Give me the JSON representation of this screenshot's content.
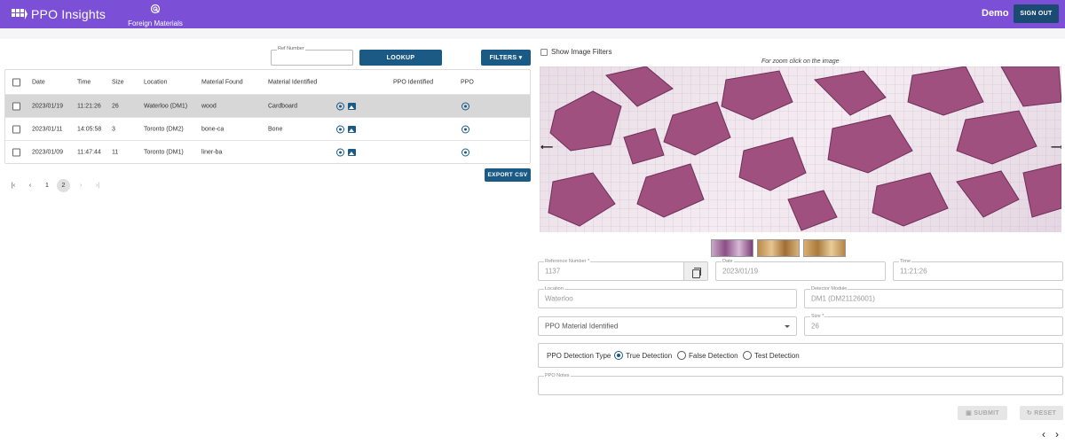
{
  "header": {
    "app_title": "PPO Insights",
    "nav_item": "Foreign Materials",
    "user": "Demo",
    "sign_out": "SIGN OUT"
  },
  "controls": {
    "ref_label": "Ref Number",
    "ref_value": "",
    "lookup": "LOOKUP",
    "filters": "FILTERS ▾",
    "show_filters": "Show Image Filters",
    "zoom_hint": "For zoom click on the image",
    "export": "EXPORT CSV"
  },
  "table": {
    "columns": [
      "Date",
      "Time",
      "Size",
      "Location",
      "Material Found",
      "Material Identified",
      "PPO Identified",
      "PPO"
    ],
    "rows": [
      {
        "date": "2023/01/19",
        "time": "11:21:26",
        "size": "26",
        "location": "Waterloo (DM1)",
        "material_found": "wood",
        "material_identified": "Cardboard",
        "selected": true
      },
      {
        "date": "2023/01/11",
        "time": "14:05:58",
        "size": "3",
        "location": "Toronto (DM2)",
        "material_found": "bone-ca",
        "material_identified": "Bone",
        "selected": false
      },
      {
        "date": "2023/01/09",
        "time": "11:47:44",
        "size": "11",
        "location": "Toronto (DM1)",
        "material_found": "liner-ba",
        "material_identified": "",
        "selected": false
      }
    ]
  },
  "pagination": {
    "first": "|‹",
    "prev": "‹",
    "pages": [
      "1",
      "2"
    ],
    "current": "2",
    "next": "›",
    "last": "›|"
  },
  "form": {
    "reference_label": "Reference Number *",
    "reference_value": "1137",
    "date_label": "Date",
    "date_value": "2023/01/19",
    "time_label": "Time",
    "time_value": "11:21:26",
    "location_label": "Location",
    "location_value": "Waterloo",
    "detector_label": "Detector Module",
    "detector_value": "DM1 (DM21126001)",
    "ppo_material_placeholder": "PPO Material Identified",
    "size_label": "Size *",
    "size_value": "26",
    "detection_type_label": "PPO Detection Type",
    "detection_options": [
      "True Detection",
      "False Detection",
      "Test Detection"
    ],
    "detection_selected": "True Detection",
    "notes_label": "PPO Notes",
    "notes_value": "",
    "submit": "SUBMIT",
    "reset": "RESET"
  },
  "icons": {
    "brand": "grid-logo-icon",
    "nav": "radar-icon",
    "row_locate": "target-icon",
    "row_image": "image-icon",
    "copy": "copy-icon"
  },
  "colors": {
    "header": "#7b4fd6",
    "primary_button": "#1b5a84",
    "selected_row": "#d7d7d7",
    "particles": "#a0507f"
  }
}
